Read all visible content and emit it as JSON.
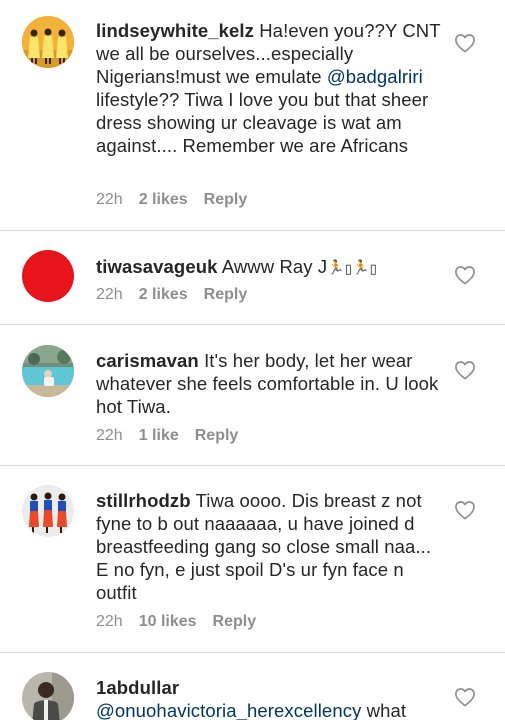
{
  "comments": [
    {
      "username": "lindseywhite_kelz",
      "text_before": " Ha!even you??Y CNT we all be ourselves...especially Nigerians!must we emulate ",
      "mention": "@badgalriri",
      "text_after": "  lifestyle?? Tiwa I love you but that sheer dress showing ur cleavage is wat am against.... Remember we are Africans",
      "time": "22h",
      "likes": "2 likes",
      "reply": "Reply"
    },
    {
      "username": "tiwasavageuk",
      "text_before": " Awww Ray J",
      "emoji_a": "🏃",
      "box_a": "▯",
      "emoji_b": "🏃",
      "box_b": "▯",
      "time": "22h",
      "likes": "2 likes",
      "reply": "Reply"
    },
    {
      "username": "carismavan",
      "text_before": " It's her body, let her wear whatever she feels comfortable in. U look hot Tiwa.",
      "time": "22h",
      "likes": "1 like",
      "reply": "Reply"
    },
    {
      "username": "stillrhodzb",
      "text_before": " Tiwa oooo. Dis breast z not fyne to b out naaaaaa, u have joined d breastfeeding gang so close small naa... E no fyn, e just spoil D's ur fyn face n outfit",
      "time": "22h",
      "likes": "10 likes",
      "reply": "Reply"
    },
    {
      "username": "1abdullar",
      "mention": "@onuohavictoria_herexcellency",
      "text_after": " what"
    }
  ],
  "colors": {
    "text": "#262626",
    "meta": "#8e8e8e",
    "mention": "#003569",
    "divider": "#dbdbdb",
    "avatar_red": "#e8141b"
  },
  "icons": [
    "heart-outline-icon"
  ]
}
